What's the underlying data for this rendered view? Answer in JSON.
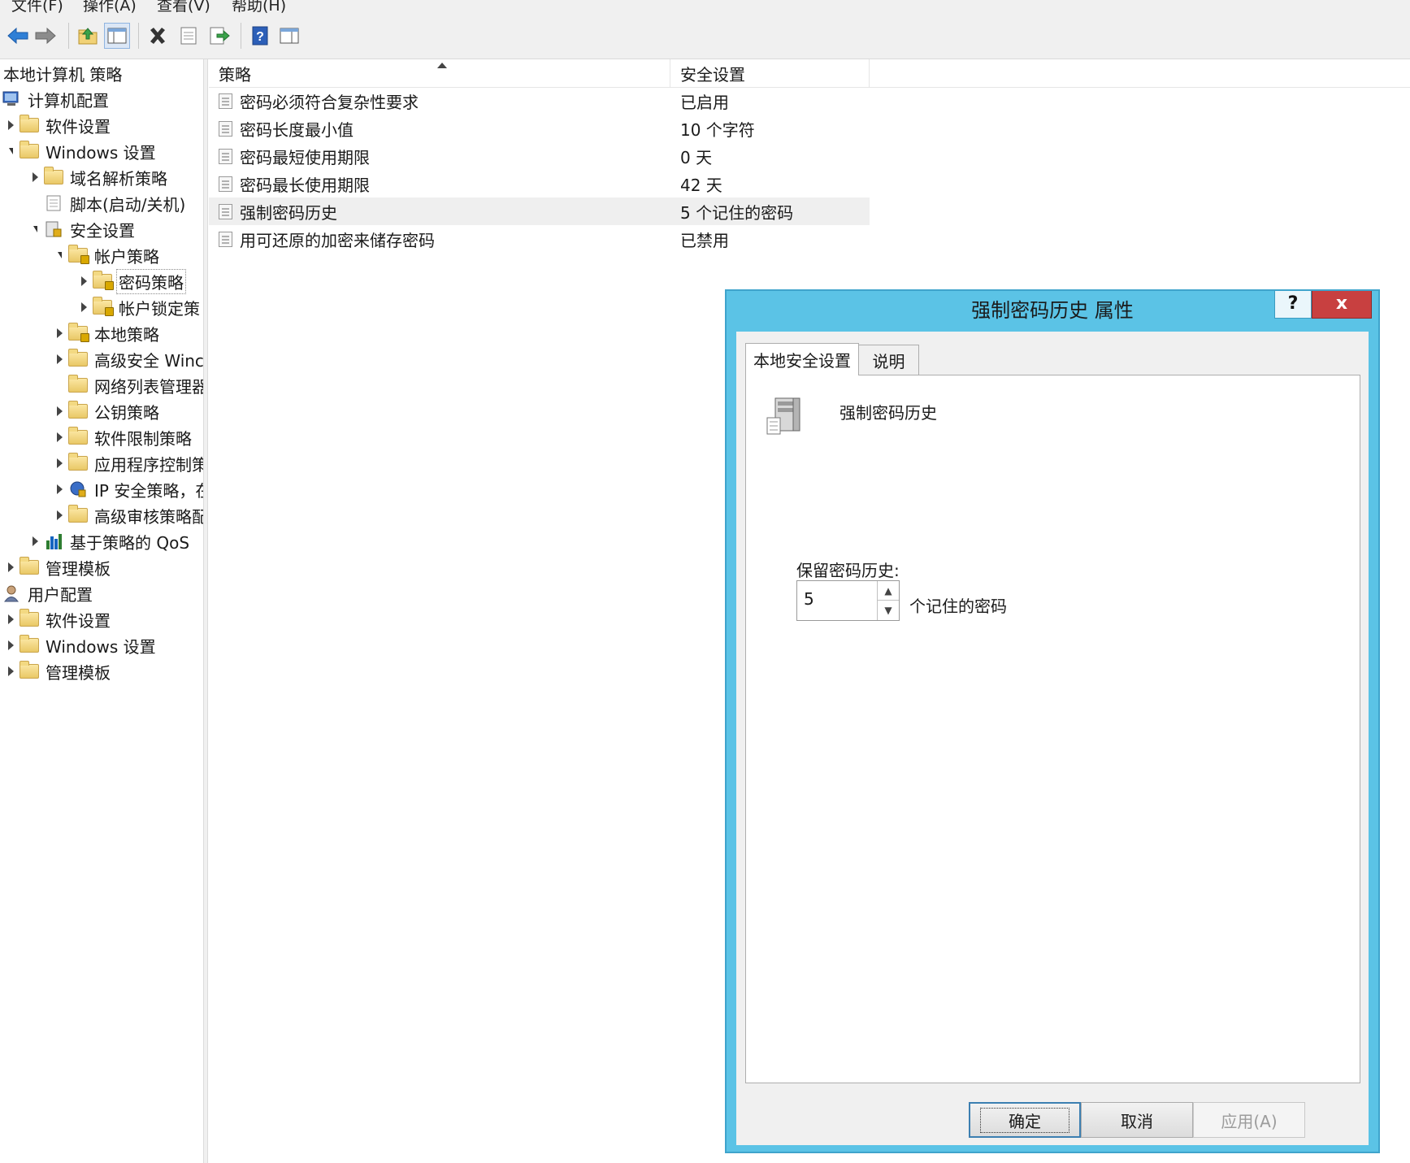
{
  "menu": [
    "文件(F)",
    "操作(A)",
    "查看(V)",
    "帮助(H)"
  ],
  "toolbar": {
    "icons": [
      "back-icon",
      "forward-icon",
      "up-folder-icon",
      "show-hide-tree-icon",
      "delete-icon",
      "properties-icon",
      "export-icon",
      "help-icon",
      "show-hide-action-pane-icon"
    ]
  },
  "tree": {
    "root": "本地计算机 策略",
    "nodes": [
      {
        "label": "计算机配置",
        "icon": "computer-icon"
      },
      {
        "label": "软件设置",
        "icon": "folder-icon"
      },
      {
        "label": "Windows 设置",
        "icon": "folder-icon"
      },
      {
        "label": "域名解析策略",
        "icon": "folder-icon"
      },
      {
        "label": "脚本(启动/关机)",
        "icon": "script-icon"
      },
      {
        "label": "安全设置",
        "icon": "security-icon"
      },
      {
        "label": "帐户策略",
        "icon": "folder-lock-icon"
      },
      {
        "label": "密码策略",
        "icon": "folder-lock-icon"
      },
      {
        "label": "帐户锁定策",
        "icon": "folder-lock-icon"
      },
      {
        "label": "本地策略",
        "icon": "folder-lock-icon"
      },
      {
        "label": "高级安全 Winc",
        "icon": "folder-icon"
      },
      {
        "label": "网络列表管理器",
        "icon": "folder-icon"
      },
      {
        "label": "公钥策略",
        "icon": "folder-icon"
      },
      {
        "label": "软件限制策略",
        "icon": "folder-icon"
      },
      {
        "label": "应用程序控制策",
        "icon": "folder-icon"
      },
      {
        "label": "IP 安全策略，在",
        "icon": "ip-security-icon"
      },
      {
        "label": "高级审核策略配",
        "icon": "folder-icon"
      },
      {
        "label": "基于策略的 QoS",
        "icon": "qos-chart-icon"
      },
      {
        "label": "管理模板",
        "icon": "folder-icon"
      },
      {
        "label": "用户配置",
        "icon": "user-icon"
      },
      {
        "label": "软件设置",
        "icon": "folder-icon"
      },
      {
        "label": "Windows 设置",
        "icon": "folder-icon"
      },
      {
        "label": "管理模板",
        "icon": "folder-icon"
      }
    ]
  },
  "list": {
    "columns": [
      "策略",
      "安全设置"
    ],
    "rows": [
      {
        "policy": "密码必须符合复杂性要求",
        "setting": "已启用"
      },
      {
        "policy": "密码长度最小值",
        "setting": "10 个字符"
      },
      {
        "policy": "密码最短使用期限",
        "setting": "0 天"
      },
      {
        "policy": "密码最长使用期限",
        "setting": "42 天"
      },
      {
        "policy": "强制密码历史",
        "setting": "5 个记住的密码"
      },
      {
        "policy": "用可还原的加密来储存密码",
        "setting": "已禁用"
      }
    ]
  },
  "dialog": {
    "title": "强制密码历史 属性",
    "help": "?",
    "close": "x",
    "tabs": [
      "本地安全设置",
      "说明"
    ],
    "policy_name": "强制密码历史",
    "keep_label": "保留密码历史:",
    "value": "5",
    "unit": "个记住的密码",
    "buttons": {
      "ok": "确定",
      "cancel": "取消",
      "apply": "应用(A)"
    },
    "accent_color": "#5bc3e6"
  }
}
